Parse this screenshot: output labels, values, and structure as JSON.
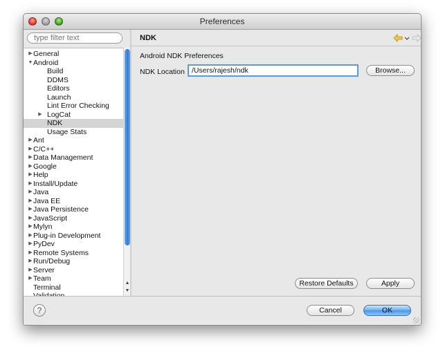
{
  "window": {
    "title": "Preferences"
  },
  "filter": {
    "placeholder": "type filter text"
  },
  "tree": [
    {
      "label": "General",
      "indent": 0,
      "twisty": "collapsed"
    },
    {
      "label": "Android",
      "indent": 0,
      "twisty": "expanded"
    },
    {
      "label": "Build",
      "indent": 1,
      "twisty": "none"
    },
    {
      "label": "DDMS",
      "indent": 1,
      "twisty": "none"
    },
    {
      "label": "Editors",
      "indent": 1,
      "twisty": "none"
    },
    {
      "label": "Launch",
      "indent": 1,
      "twisty": "none"
    },
    {
      "label": "Lint Error Checking",
      "indent": 1,
      "twisty": "none"
    },
    {
      "label": "LogCat",
      "indent": 1,
      "twisty": "collapsed"
    },
    {
      "label": "NDK",
      "indent": 1,
      "twisty": "none",
      "selected": true
    },
    {
      "label": "Usage Stats",
      "indent": 1,
      "twisty": "none"
    },
    {
      "label": "Ant",
      "indent": 0,
      "twisty": "collapsed"
    },
    {
      "label": "C/C++",
      "indent": 0,
      "twisty": "collapsed"
    },
    {
      "label": "Data Management",
      "indent": 0,
      "twisty": "collapsed"
    },
    {
      "label": "Google",
      "indent": 0,
      "twisty": "collapsed"
    },
    {
      "label": "Help",
      "indent": 0,
      "twisty": "collapsed"
    },
    {
      "label": "Install/Update",
      "indent": 0,
      "twisty": "collapsed"
    },
    {
      "label": "Java",
      "indent": 0,
      "twisty": "collapsed"
    },
    {
      "label": "Java EE",
      "indent": 0,
      "twisty": "collapsed"
    },
    {
      "label": "Java Persistence",
      "indent": 0,
      "twisty": "collapsed"
    },
    {
      "label": "JavaScript",
      "indent": 0,
      "twisty": "collapsed"
    },
    {
      "label": "Mylyn",
      "indent": 0,
      "twisty": "collapsed"
    },
    {
      "label": "Plug-in Development",
      "indent": 0,
      "twisty": "collapsed"
    },
    {
      "label": "PyDev",
      "indent": 0,
      "twisty": "collapsed"
    },
    {
      "label": "Remote Systems",
      "indent": 0,
      "twisty": "collapsed"
    },
    {
      "label": "Run/Debug",
      "indent": 0,
      "twisty": "collapsed"
    },
    {
      "label": "Server",
      "indent": 0,
      "twisty": "collapsed"
    },
    {
      "label": "Team",
      "indent": 0,
      "twisty": "collapsed"
    },
    {
      "label": "Terminal",
      "indent": 0,
      "twisty": "none"
    },
    {
      "label": "Validation",
      "indent": 0,
      "twisty": "none"
    }
  ],
  "page": {
    "title": "NDK",
    "description": "Android NDK Preferences",
    "ndk_location_label": "NDK Location",
    "ndk_location_value": "/Users/rajesh/ndk",
    "browse_label": "Browse...",
    "restore_defaults_label": "Restore Defaults",
    "apply_label": "Apply"
  },
  "nav": {
    "back_icon": "back-arrow-icon",
    "forward_icon": "forward-arrow-icon",
    "menu_icon": "view-menu-icon"
  },
  "footer": {
    "help_glyph": "?",
    "cancel_label": "Cancel",
    "ok_label": "OK"
  },
  "colors": {
    "accent": "#4a95e8",
    "selection": "#d4d4d4",
    "nav_back": "#d8a512"
  }
}
